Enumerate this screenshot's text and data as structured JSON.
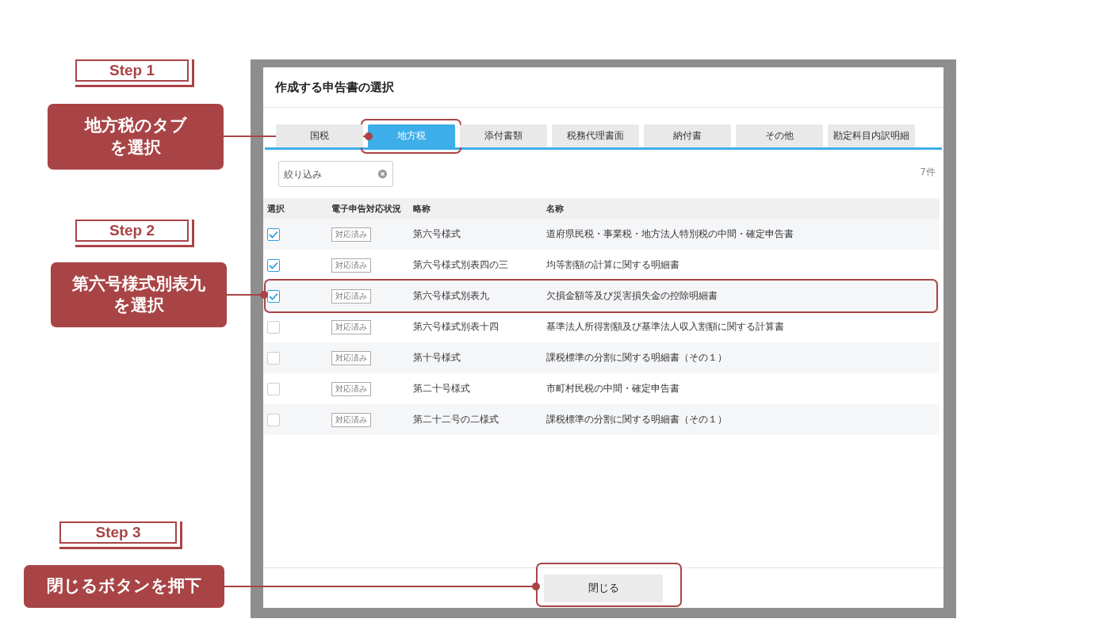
{
  "dialog": {
    "title": "作成する申告書の選択",
    "tabs": [
      {
        "label": "国税",
        "selected": false
      },
      {
        "label": "地方税",
        "selected": true
      },
      {
        "label": "添付書類",
        "selected": false
      },
      {
        "label": "税務代理書面",
        "selected": false
      },
      {
        "label": "納付書",
        "selected": false
      },
      {
        "label": "その他",
        "selected": false
      },
      {
        "label": "勘定科目内訳明細",
        "selected": false
      }
    ],
    "filter": {
      "placeholder": "絞り込み"
    },
    "count": "7件",
    "table": {
      "columns": [
        "選択",
        "電子申告対応状況",
        "略称",
        "名称"
      ],
      "rows": [
        {
          "checked": true,
          "status": "対応済み",
          "abbr": "第六号様式",
          "name": "道府県民税・事業税・地方法人特別税の中間・確定申告書"
        },
        {
          "checked": true,
          "status": "対応済み",
          "abbr": "第六号様式別表四の三",
          "name": "均等割額の計算に関する明細書"
        },
        {
          "checked": true,
          "status": "対応済み",
          "abbr": "第六号様式別表九",
          "name": "欠損金額等及び災害損失金の控除明細書"
        },
        {
          "checked": false,
          "status": "対応済み",
          "abbr": "第六号様式別表十四",
          "name": "基準法人所得割額及び基準法人収入割額に関する計算書"
        },
        {
          "checked": false,
          "status": "対応済み",
          "abbr": "第十号様式",
          "name": "課税標準の分割に関する明細書（その１）"
        },
        {
          "checked": false,
          "status": "対応済み",
          "abbr": "第二十号様式",
          "name": "市町村民税の中間・確定申告書"
        },
        {
          "checked": false,
          "status": "対応済み",
          "abbr": "第二十二号の二様式",
          "name": "課税標準の分割に関する明細書（その１）"
        }
      ]
    },
    "close_button": "閉じる"
  },
  "steps": [
    {
      "label": "Step 1",
      "callout": "地方税のタブを選択"
    },
    {
      "label": "Step 2",
      "callout": "第六号様式別表九を選択"
    },
    {
      "label": "Step 3",
      "callout": "閉じるボタンを押下"
    }
  ]
}
